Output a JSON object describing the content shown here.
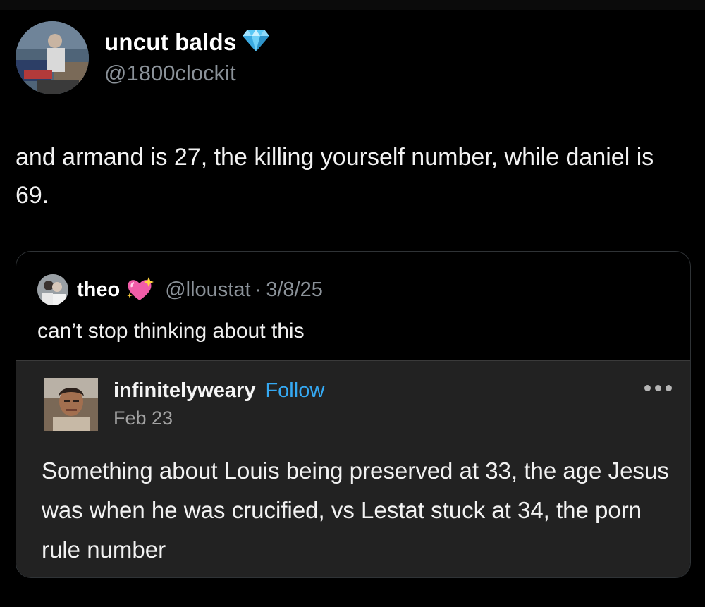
{
  "post": {
    "author_name": "uncut balds",
    "author_handle": "@1800clockit",
    "badge_icon": "diamond-icon",
    "text": "and armand is 27, the killing yourself number, while daniel is 69."
  },
  "quote": {
    "name": "theo",
    "badge_icon": "sparkling-heart-icon",
    "handle": "@lloustat",
    "separator": "·",
    "date": "3/8/25",
    "text": "can’t stop thinking about this"
  },
  "embed": {
    "name": "infinitelyweary",
    "follow_label": "Follow",
    "date": "Feb 23",
    "more_icon": "more-options-icon",
    "text": "Something about Louis being preserved at 33, the age Jesus was when he was crucified, vs Lestat stuck at 34, the porn rule number",
    "follow_color": "#35a9f3"
  },
  "colors": {
    "background": "#000000",
    "handle_gray": "#8b9299",
    "embed_background": "#222222",
    "diamond": "#5bc8f5",
    "heart": "#f15ca8"
  }
}
